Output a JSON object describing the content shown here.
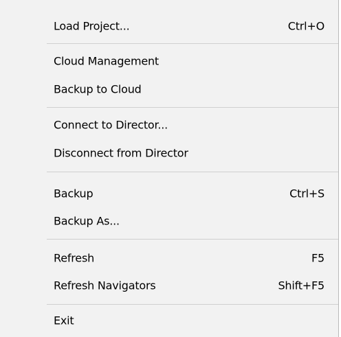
{
  "menu": {
    "items": [
      {
        "label": "Load Project...",
        "shortcut": "Ctrl+O"
      },
      {
        "label": "Cloud Management",
        "shortcut": ""
      },
      {
        "label": "Backup to Cloud",
        "shortcut": ""
      },
      {
        "label": "Connect to Director...",
        "shortcut": ""
      },
      {
        "label": "Disconnect from Director",
        "shortcut": ""
      },
      {
        "label": "Backup",
        "shortcut": "Ctrl+S"
      },
      {
        "label": "Backup As...",
        "shortcut": ""
      },
      {
        "label": "Refresh",
        "shortcut": "F5"
      },
      {
        "label": "Refresh Navigators",
        "shortcut": "Shift+F5"
      },
      {
        "label": "Exit",
        "shortcut": ""
      }
    ]
  }
}
